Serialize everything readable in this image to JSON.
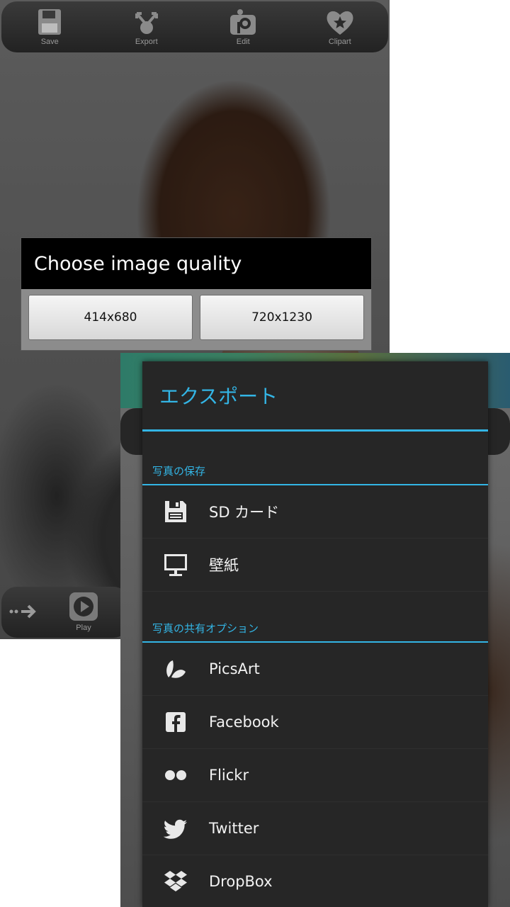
{
  "screen1": {
    "toolbar": {
      "items": [
        {
          "label": "Save",
          "icon": "floppy-disk-icon"
        },
        {
          "label": "Export",
          "icon": "share-arrows-icon"
        },
        {
          "label": "Edit",
          "icon": "picsart-edit-icon"
        },
        {
          "label": "Clipart",
          "icon": "heart-star-icon"
        }
      ]
    },
    "dialog": {
      "title": "Choose image quality",
      "options": [
        "414x680",
        "720x1230"
      ]
    },
    "bottombar": {
      "play_label": "Play"
    }
  },
  "screen2": {
    "panel": {
      "title": "エクスポート",
      "sections": [
        {
          "header": "写真の保存",
          "items": [
            {
              "label": "SD カード",
              "icon": "sd-card-save-icon"
            },
            {
              "label": "壁紙",
              "icon": "monitor-icon"
            }
          ]
        },
        {
          "header": "写真の共有オプション",
          "items": [
            {
              "label": "PicsArt",
              "icon": "picsart-logo-icon"
            },
            {
              "label": "Facebook",
              "icon": "facebook-icon"
            },
            {
              "label": "Flickr",
              "icon": "flickr-icon"
            },
            {
              "label": "Twitter",
              "icon": "twitter-bird-icon"
            },
            {
              "label": "DropBox",
              "icon": "dropbox-icon"
            }
          ]
        }
      ]
    }
  },
  "colors": {
    "accent": "#33b5e5",
    "panel_bg": "#262626",
    "dialog_title_bg": "#000000"
  }
}
